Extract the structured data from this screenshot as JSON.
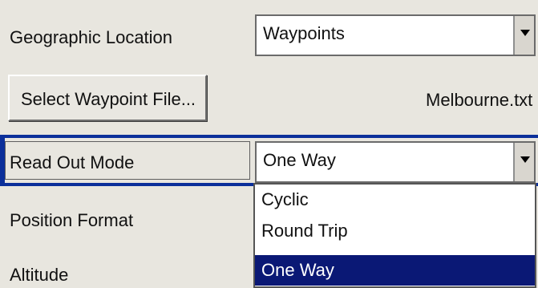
{
  "geographic_location": {
    "label": "Geographic Location",
    "value": "Waypoints"
  },
  "waypoint_file": {
    "button_label": "Select Waypoint File...",
    "file_name": "Melbourne.txt"
  },
  "read_out_mode": {
    "label": "Read Out Mode",
    "value": "One Way",
    "options": [
      "Cyclic",
      "Round Trip",
      "One Way"
    ],
    "selected_index": 2
  },
  "position_format": {
    "label": "Position Format"
  },
  "altitude": {
    "label": "Altitude"
  },
  "colors": {
    "background": "#e8e6df",
    "focus_border": "#0b2f9a",
    "selected_option": "#0a1875"
  }
}
